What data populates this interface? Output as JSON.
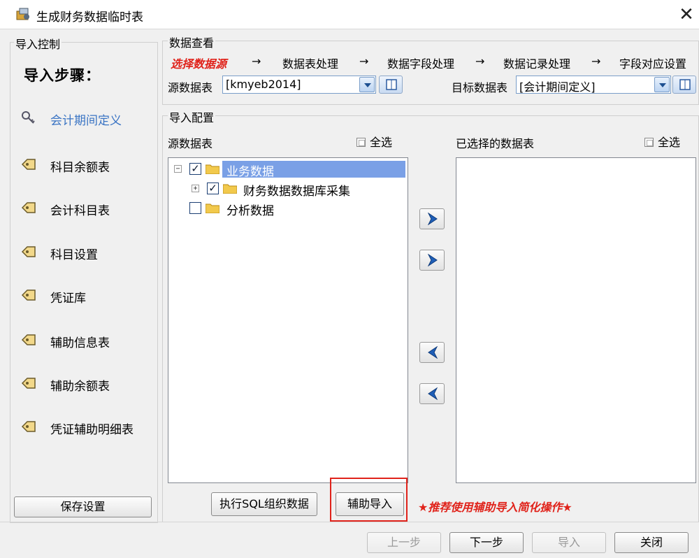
{
  "window": {
    "title": "生成财务数据临时表",
    "close_symbol": "✕"
  },
  "left_panel": {
    "group_title": "导入控制",
    "heading": "导入步骤：",
    "steps": [
      {
        "label": "会计期间定义",
        "active": true
      },
      {
        "label": "科目余额表"
      },
      {
        "label": "会计科目表"
      },
      {
        "label": "科目设置"
      },
      {
        "label": "凭证库"
      },
      {
        "label": "辅助信息表"
      },
      {
        "label": "辅助余额表"
      },
      {
        "label": "凭证辅助明细表"
      }
    ],
    "save_button": "保存设置"
  },
  "data_view": {
    "group_title": "数据查看",
    "flow": [
      "选择数据源",
      "数据表处理",
      "数据字段处理",
      "数据记录处理",
      "字段对应设置"
    ],
    "arrow": "→",
    "source_label": "源数据表",
    "source_value": "[kmyeb2014]",
    "target_label": "目标数据表",
    "target_value": "[会计期间定义]"
  },
  "import_config": {
    "group_title": "导入配置",
    "source_tables_label": "源数据表",
    "selected_tables_label": "已选择的数据表",
    "select_all": "全选",
    "tree": [
      {
        "label": "业务数据",
        "checked": true,
        "expander": "−",
        "selected": true
      },
      {
        "label": "财务数据数据库采集",
        "checked": true,
        "expander": "+"
      },
      {
        "label": "分析数据",
        "checked": false
      }
    ],
    "execute_sql_button": "执行SQL组织数据",
    "assist_import_button": "辅助导入",
    "note": "★推荐使用辅助导入简化操作★"
  },
  "footer": {
    "prev_button": "上一步",
    "next_button": "下一步",
    "import_button": "导入",
    "close_button": "关闭"
  },
  "colors": {
    "accent_red": "#e0231b",
    "active_step_blue": "#3a74c4",
    "tree_selection": "#7aa0e6"
  }
}
